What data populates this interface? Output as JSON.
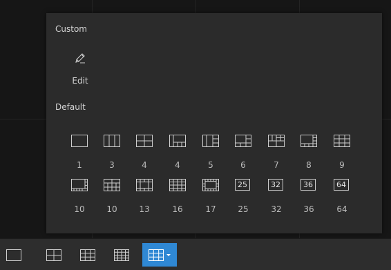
{
  "popup": {
    "custom_label": "Custom",
    "edit_label": "Edit",
    "default_label": "Default",
    "layouts_row1": [
      "1",
      "3",
      "4",
      "4",
      "5",
      "6",
      "7",
      "8",
      "9"
    ],
    "layouts_row2": [
      "10",
      "10",
      "13",
      "16",
      "17",
      "25",
      "32",
      "36",
      "64"
    ],
    "icon_numbers": {
      "n25": "25",
      "n32": "32",
      "n36": "36",
      "n64": "64"
    }
  },
  "toolbar": {
    "buttons": [
      {
        "icon": "single-view-icon"
      },
      {
        "icon": "four-view-icon"
      },
      {
        "icon": "nine-view-icon"
      },
      {
        "icon": "sixteen-view-icon"
      },
      {
        "icon": "more-layouts-icon",
        "active": true
      }
    ]
  },
  "colors": {
    "background": "#161616",
    "popup": "#2b2b2b",
    "toolbar": "#2d2d2d",
    "accent": "#2f88d4",
    "text": "#d6d6d6"
  }
}
